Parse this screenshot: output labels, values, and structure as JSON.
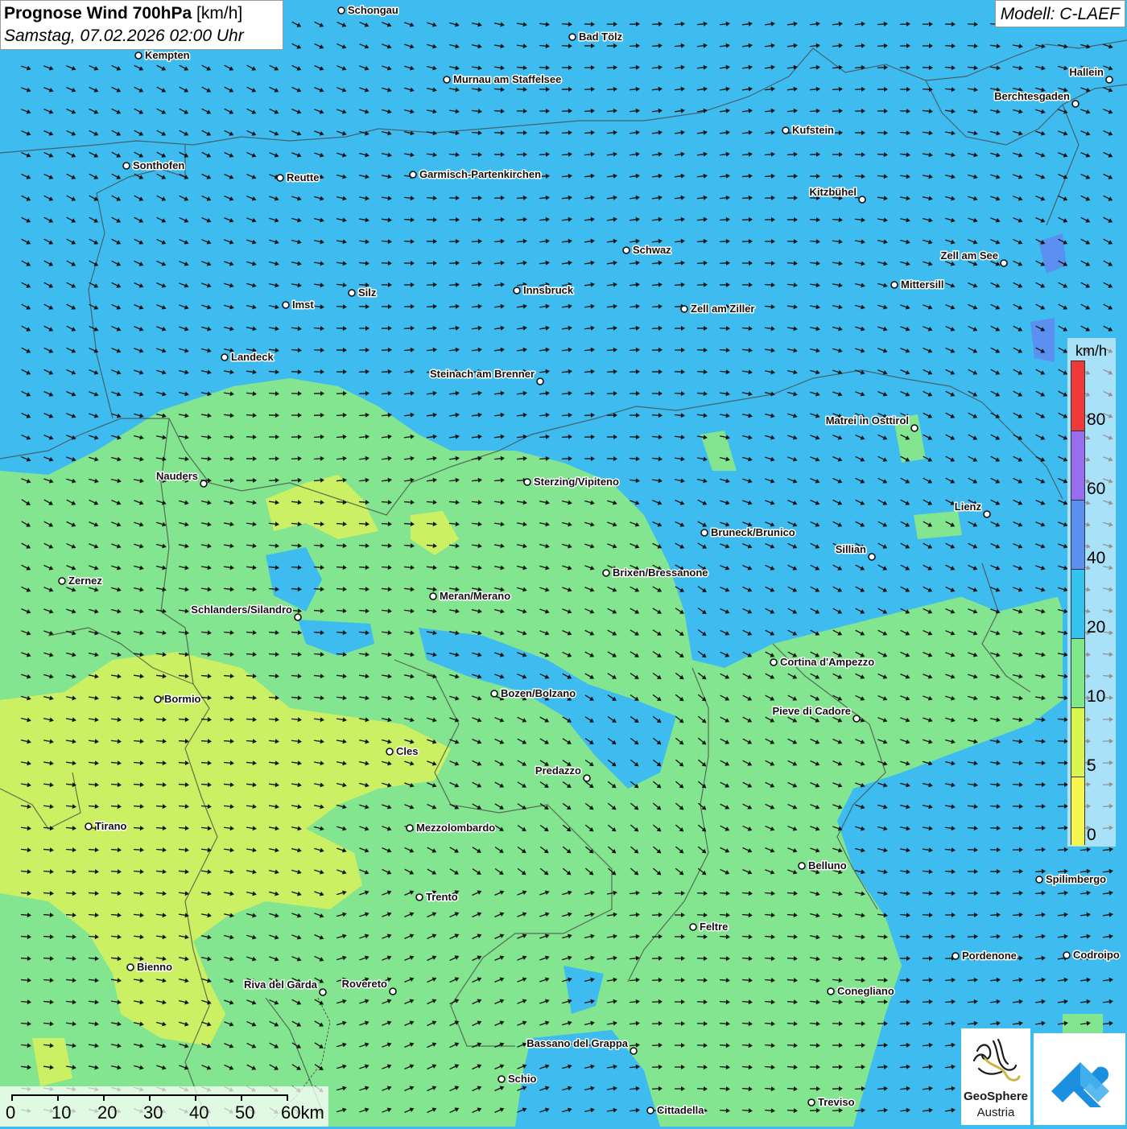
{
  "header": {
    "title_bold": "Prognose Wind 700hPa",
    "title_unit": "[km/h]",
    "datetime": "Samstag, 07.02.2026 02:00 Uhr",
    "model": "Modell: C-LAEF"
  },
  "legend": {
    "unit": "km/h",
    "ticks": [
      "80",
      "60",
      "40",
      "20",
      "10",
      "5",
      "0"
    ],
    "colors": [
      "#ef3a3a",
      "#9a6cf0",
      "#5b8ff0",
      "#33c3f0",
      "#7fe98a",
      "#d8f550",
      "#f5f550"
    ]
  },
  "scale_bar": {
    "labels": [
      "0",
      "10",
      "20",
      "30",
      "40",
      "50",
      "60km"
    ]
  },
  "logos": {
    "geosphere_line1": "GeoSphere",
    "geosphere_line2": "Austria"
  },
  "colors": {
    "wind_20_40": "#3fbcef",
    "wind_10_20": "#83e58f",
    "wind_5_10": "#d9f25c",
    "wind_40_60": "#5b8ff0",
    "border": "#444444",
    "arrow": "#111111"
  },
  "cities": [
    {
      "name": "Schongau"
    },
    {
      "name": "Bad Tölz"
    },
    {
      "name": "Kempten"
    },
    {
      "name": "Murnau am Staffelsee"
    },
    {
      "name": "Hallein"
    },
    {
      "name": "Berchtesgaden"
    },
    {
      "name": "Kufstein"
    },
    {
      "name": "Sonthofen"
    },
    {
      "name": "Reutte"
    },
    {
      "name": "Garmisch-Partenkirchen"
    },
    {
      "name": "Kitzbühel"
    },
    {
      "name": "Schwaz"
    },
    {
      "name": "Zell am See"
    },
    {
      "name": "Innsbruck"
    },
    {
      "name": "Mittersill"
    },
    {
      "name": "Silz"
    },
    {
      "name": "Imst"
    },
    {
      "name": "Zell am Ziller"
    },
    {
      "name": "Landeck"
    },
    {
      "name": "Steinach am Brenner"
    },
    {
      "name": "Matrei in Osttirol"
    },
    {
      "name": "Nauders"
    },
    {
      "name": "Sterzing/Vipiteno"
    },
    {
      "name": "Lienz"
    },
    {
      "name": "Bruneck/Brunico"
    },
    {
      "name": "Sillian"
    },
    {
      "name": "Zernez"
    },
    {
      "name": "Brixen/Bressanone"
    },
    {
      "name": "Meran/Merano"
    },
    {
      "name": "Schlanders/Silandro"
    },
    {
      "name": "Cortina d'Ampezzo"
    },
    {
      "name": "Bozen/Bolzano"
    },
    {
      "name": "Bormio"
    },
    {
      "name": "Pieve di Cadore"
    },
    {
      "name": "Cles"
    },
    {
      "name": "Predazzo"
    },
    {
      "name": "Tirano"
    },
    {
      "name": "Mezzolombardo"
    },
    {
      "name": "Belluno"
    },
    {
      "name": "Spilimbergo"
    },
    {
      "name": "Trento"
    },
    {
      "name": "Feltre"
    },
    {
      "name": "Pordenone"
    },
    {
      "name": "Codroipo"
    },
    {
      "name": "Bienno"
    },
    {
      "name": "Riva del Garda"
    },
    {
      "name": "Rovereto"
    },
    {
      "name": "Conegliano"
    },
    {
      "name": "Bassano del Grappa"
    },
    {
      "name": "Schio"
    },
    {
      "name": "Treviso"
    },
    {
      "name": "Cittadella"
    }
  ]
}
